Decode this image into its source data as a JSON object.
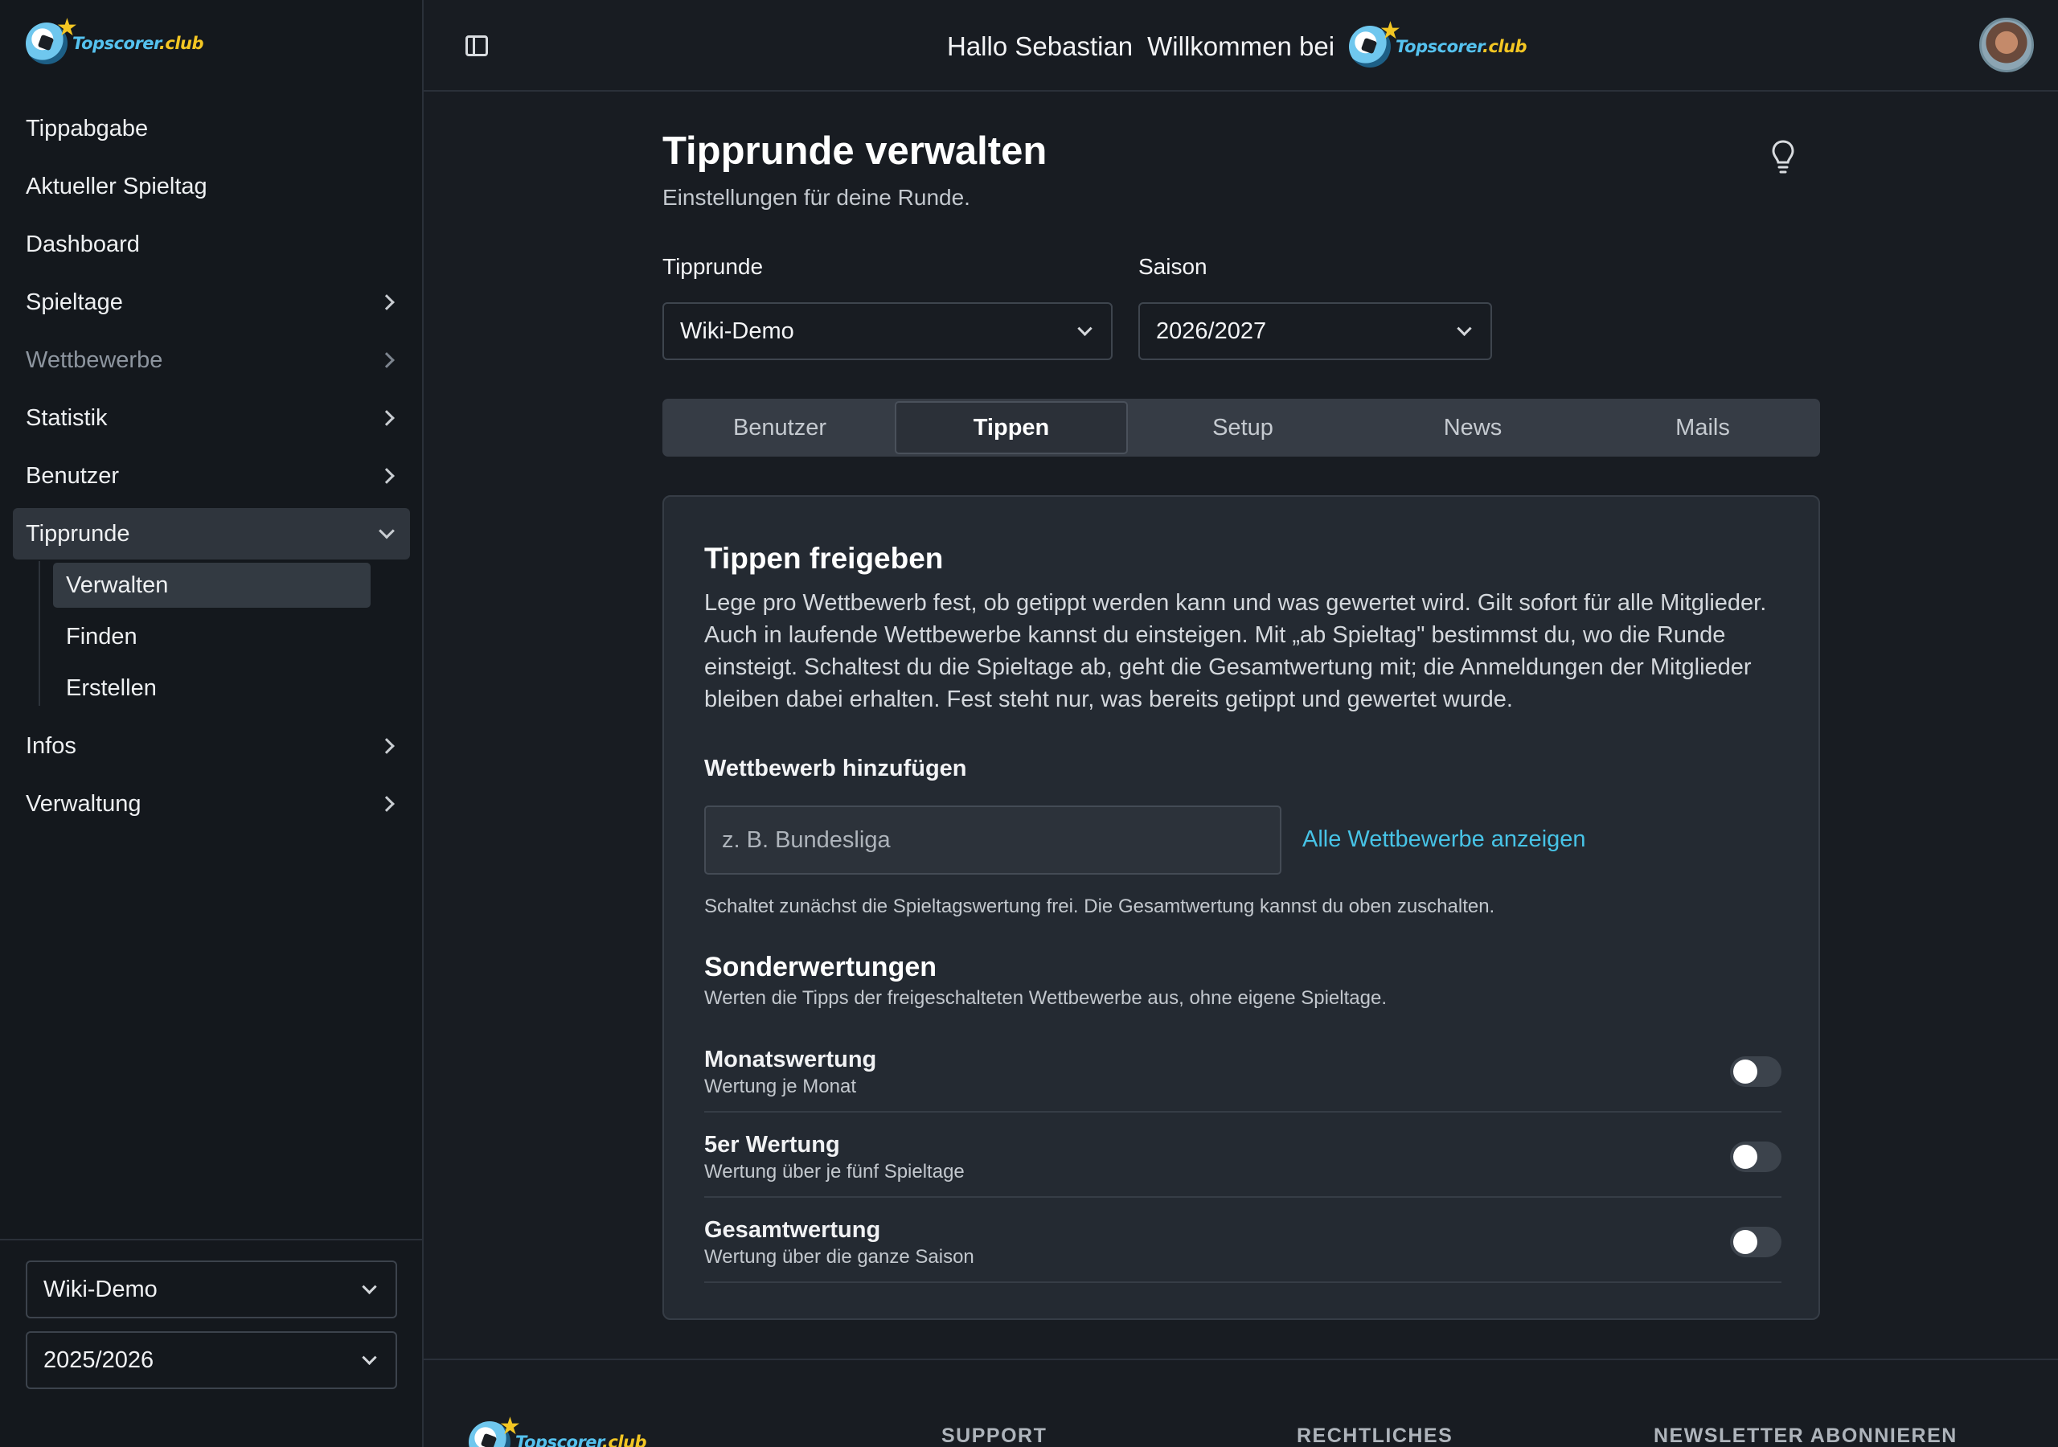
{
  "brand": {
    "logo_text": "Topscorer",
    "logo_suffix": ".club"
  },
  "header": {
    "greeting": "Hallo Sebastian",
    "welcome": "Willkommen bei"
  },
  "sidebar": {
    "items": [
      {
        "label": "Tippabgabe"
      },
      {
        "label": "Aktueller Spieltag"
      },
      {
        "label": "Dashboard"
      },
      {
        "label": "Spieltage"
      },
      {
        "label": "Wettbewerbe"
      },
      {
        "label": "Statistik"
      },
      {
        "label": "Benutzer"
      },
      {
        "label": "Tipprunde"
      },
      {
        "label": "Infos"
      },
      {
        "label": "Verwaltung"
      }
    ],
    "subitems": [
      {
        "label": "Verwalten"
      },
      {
        "label": "Finden"
      },
      {
        "label": "Erstellen"
      }
    ],
    "round_select": "Wiki-Demo",
    "season_select": "2025/2026"
  },
  "main": {
    "title": "Tipprunde verwalten",
    "subtitle": "Einstellungen für deine Runde.",
    "round_label": "Tipprunde",
    "round_value": "Wiki-Demo",
    "season_label": "Saison",
    "season_value": "2026/2027",
    "tabs": [
      {
        "label": "Benutzer"
      },
      {
        "label": "Tippen"
      },
      {
        "label": "Setup"
      },
      {
        "label": "News"
      },
      {
        "label": "Mails"
      }
    ],
    "active_tab": "Tippen"
  },
  "card": {
    "title": "Tippen freigeben",
    "description": "Lege pro Wettbewerb fest, ob getippt werden kann und was gewertet wird. Gilt sofort für alle Mitglieder. Auch in laufende Wettbewerbe kannst du einsteigen. Mit „ab Spieltag\" bestimmst du, wo die Runde einsteigt. Schaltest du die Spieltage ab, geht die Gesamtwertung mit; die Anmeldungen der Mitglieder bleiben dabei erhalten. Fest steht nur, was bereits getippt und gewertet wurde.",
    "add_label": "Wettbewerb hinzufügen",
    "add_placeholder": "z. B. Bundesliga",
    "show_all": "Alle Wettbewerbe anzeigen",
    "hint": "Schaltet zunächst die Spieltagswertung frei. Die Gesamtwertung kannst du oben zuschalten.",
    "special_title": "Sonderwertungen",
    "special_sub": "Werten die Tipps der freigeschalteten Wettbewerbe aus, ohne eigene Spieltage.",
    "rows": [
      {
        "title": "Monatswertung",
        "sub": "Wertung je Monat",
        "enabled": false
      },
      {
        "title": "5er Wertung",
        "sub": "Wertung über je fünf Spieltage",
        "enabled": false
      },
      {
        "title": "Gesamtwertung",
        "sub": "Wertung über die ganze Saison",
        "enabled": false
      }
    ]
  },
  "footer": {
    "support": "SUPPORT",
    "legal": "RECHTLICHES",
    "newsletter": "NEWSLETTER ABONNIEREN"
  },
  "colors": {
    "accent": "#47c3e6",
    "background": "#181c22",
    "sidebar": "#14181d",
    "card": "#242a32"
  },
  "icons": {
    "panel_toggle": "sidebar-toggle-icon",
    "hint": "lightbulb-icon",
    "chevron": "chevron-right-icon"
  }
}
